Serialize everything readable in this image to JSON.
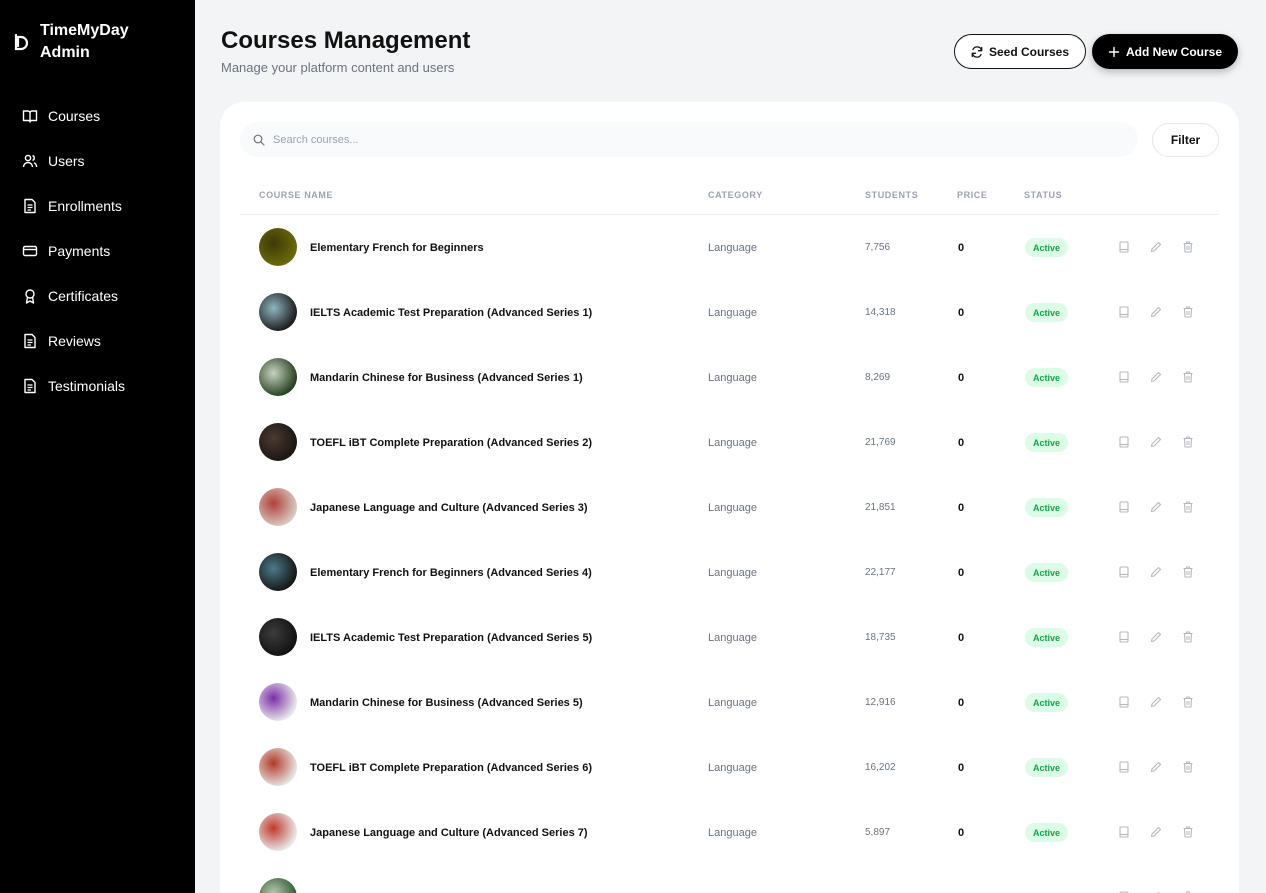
{
  "brand": {
    "line1": "TimeMyDay",
    "line2": "Admin"
  },
  "nav": [
    {
      "label": "Courses",
      "icon": "book-open-icon"
    },
    {
      "label": "Users",
      "icon": "users-icon"
    },
    {
      "label": "Enrollments",
      "icon": "file-text-icon"
    },
    {
      "label": "Payments",
      "icon": "credit-card-icon"
    },
    {
      "label": "Certificates",
      "icon": "award-icon"
    },
    {
      "label": "Reviews",
      "icon": "file-text-icon"
    },
    {
      "label": "Testimonials",
      "icon": "file-text-icon"
    }
  ],
  "header": {
    "title": "Courses Management",
    "subtitle": "Manage your platform content and users",
    "seed_label": "Seed Courses",
    "add_label": "Add New Course"
  },
  "search": {
    "placeholder": "Search courses..."
  },
  "filter_label": "Filter",
  "columns": [
    "COURSE NAME",
    "CATEGORY",
    "STUDENTS",
    "PRICE",
    "STATUS"
  ],
  "courses": [
    {
      "name": "Elementary French for Beginners",
      "category": "Language",
      "students": "7,756",
      "price": "0",
      "status": "Active",
      "thumb": [
        "#6b6a0a",
        "#3d3a05"
      ]
    },
    {
      "name": "IELTS Academic Test Preparation (Advanced Series 1)",
      "category": "Language",
      "students": "14,318",
      "price": "0",
      "status": "Active",
      "thumb": [
        "#1c1c1c",
        "#8fb6c2"
      ]
    },
    {
      "name": "Mandarin Chinese for Business (Advanced Series 1)",
      "category": "Language",
      "students": "8,269",
      "price": "0",
      "status": "Active",
      "thumb": [
        "#25401f",
        "#c7d3c0"
      ]
    },
    {
      "name": "TOEFL iBT Complete Preparation (Advanced Series 2)",
      "category": "Language",
      "students": "21,769",
      "price": "0",
      "status": "Active",
      "thumb": [
        "#1a1613",
        "#4a3a2f"
      ]
    },
    {
      "name": "Japanese Language and Culture (Advanced Series 3)",
      "category": "Language",
      "students": "21,851",
      "price": "0",
      "status": "Active",
      "thumb": [
        "#d8c9c0",
        "#b0403a"
      ]
    },
    {
      "name": "Elementary French for Beginners (Advanced Series 4)",
      "category": "Language",
      "students": "22,177",
      "price": "0",
      "status": "Active",
      "thumb": [
        "#161616",
        "#4b7a8a"
      ]
    },
    {
      "name": "IELTS Academic Test Preparation (Advanced Series 5)",
      "category": "Language",
      "students": "18,735",
      "price": "0",
      "status": "Active",
      "thumb": [
        "#121212",
        "#3c3c3c"
      ]
    },
    {
      "name": "Mandarin Chinese for Business (Advanced Series 5)",
      "category": "Language",
      "students": "12,916",
      "price": "0",
      "status": "Active",
      "thumb": [
        "#e8e8ea",
        "#7b2fa8"
      ]
    },
    {
      "name": "TOEFL iBT Complete Preparation (Advanced Series 6)",
      "category": "Language",
      "students": "16,202",
      "price": "0",
      "status": "Active",
      "thumb": [
        "#e6e4df",
        "#b23a2a"
      ]
    },
    {
      "name": "Japanese Language and Culture (Advanced Series 7)",
      "category": "Language",
      "students": "5,897",
      "price": "0",
      "status": "Active",
      "thumb": [
        "#e9e9e9",
        "#c0392b"
      ]
    },
    {
      "name": "",
      "category": "",
      "students": "",
      "price": "",
      "status": "",
      "thumb": [
        "#2e5a34",
        "#b9c8b0"
      ]
    }
  ],
  "colors": {
    "accent": "#000000",
    "badge_bg": "#dcfce7",
    "badge_text": "#16a34a"
  }
}
